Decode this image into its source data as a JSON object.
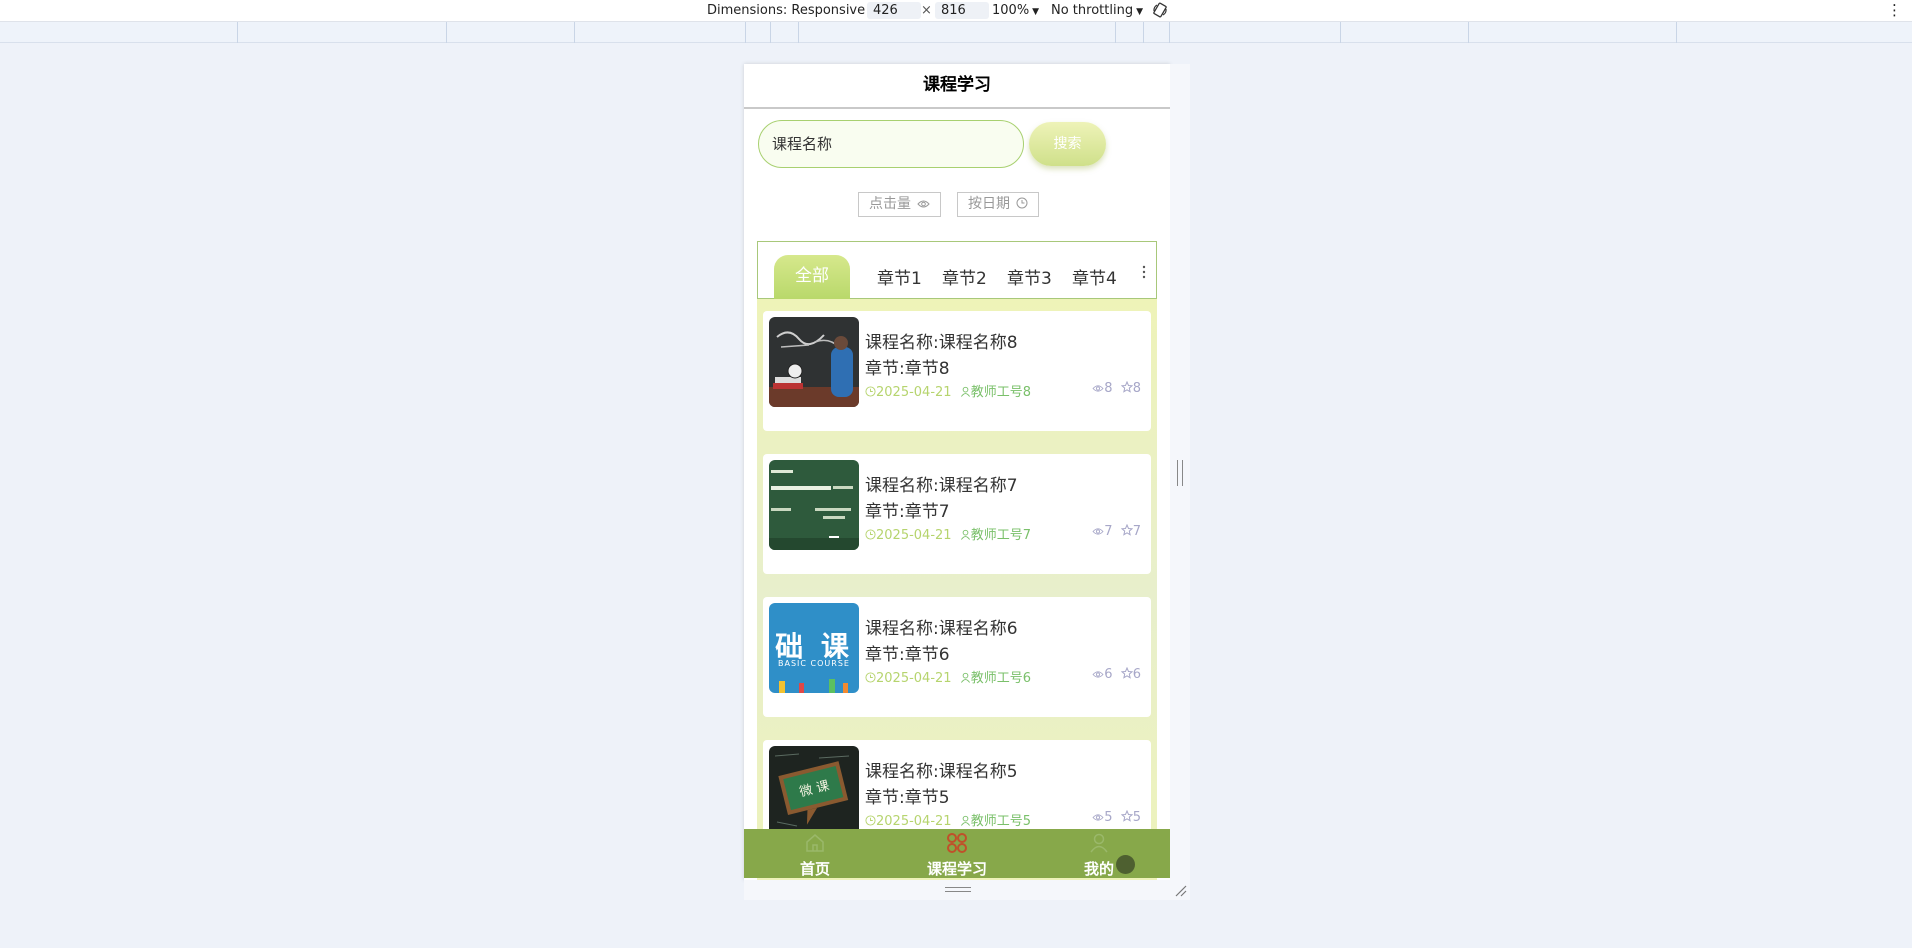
{
  "devtools": {
    "dimensions_label": "Dimensions: Responsive",
    "width_value": "426",
    "times": "×",
    "height_value": "816",
    "zoom": "100%",
    "throttling": "No throttling"
  },
  "page": {
    "title": "课程学习",
    "search": {
      "value": "课程名称",
      "button": "搜索"
    },
    "sort": {
      "by_clicks": "点击量",
      "by_date": "按日期"
    },
    "tabs": [
      "全部",
      "章节1",
      "章节2",
      "章节3",
      "章节4"
    ],
    "active_tab": "全部",
    "cards": [
      {
        "title": "课程名称:课程名称8",
        "chapter": "章节:章节8",
        "date": "2025-04-21",
        "teacher": "教师工号8",
        "views": "8",
        "favorites": "8"
      },
      {
        "title": "课程名称:课程名称7",
        "chapter": "章节:章节7",
        "date": "2025-04-21",
        "teacher": "教师工号7",
        "views": "7",
        "favorites": "7"
      },
      {
        "title": "课程名称:课程名称6",
        "chapter": "章节:章节6",
        "date": "2025-04-21",
        "teacher": "教师工号6",
        "views": "6",
        "favorites": "6"
      },
      {
        "title": "课程名称:课程名称5",
        "chapter": "章节:章节5",
        "date": "2025-04-21",
        "teacher": "教师工号5",
        "views": "5",
        "favorites": "5"
      }
    ],
    "thumb_texts": [
      "础 课",
      "BASIC COURSE",
      "微 课"
    ],
    "nav": [
      {
        "label": "首页",
        "icon": "home-icon"
      },
      {
        "label": "课程学习",
        "icon": "grid-icon"
      },
      {
        "label": "我的",
        "icon": "user-icon"
      }
    ]
  },
  "colors": {
    "accent": "#87a84a",
    "tab_active": "#b8d86a",
    "meta_date": "#b6d46e",
    "meta_teacher": "#7ac06a",
    "nav_active_icon": "#c0502a"
  }
}
